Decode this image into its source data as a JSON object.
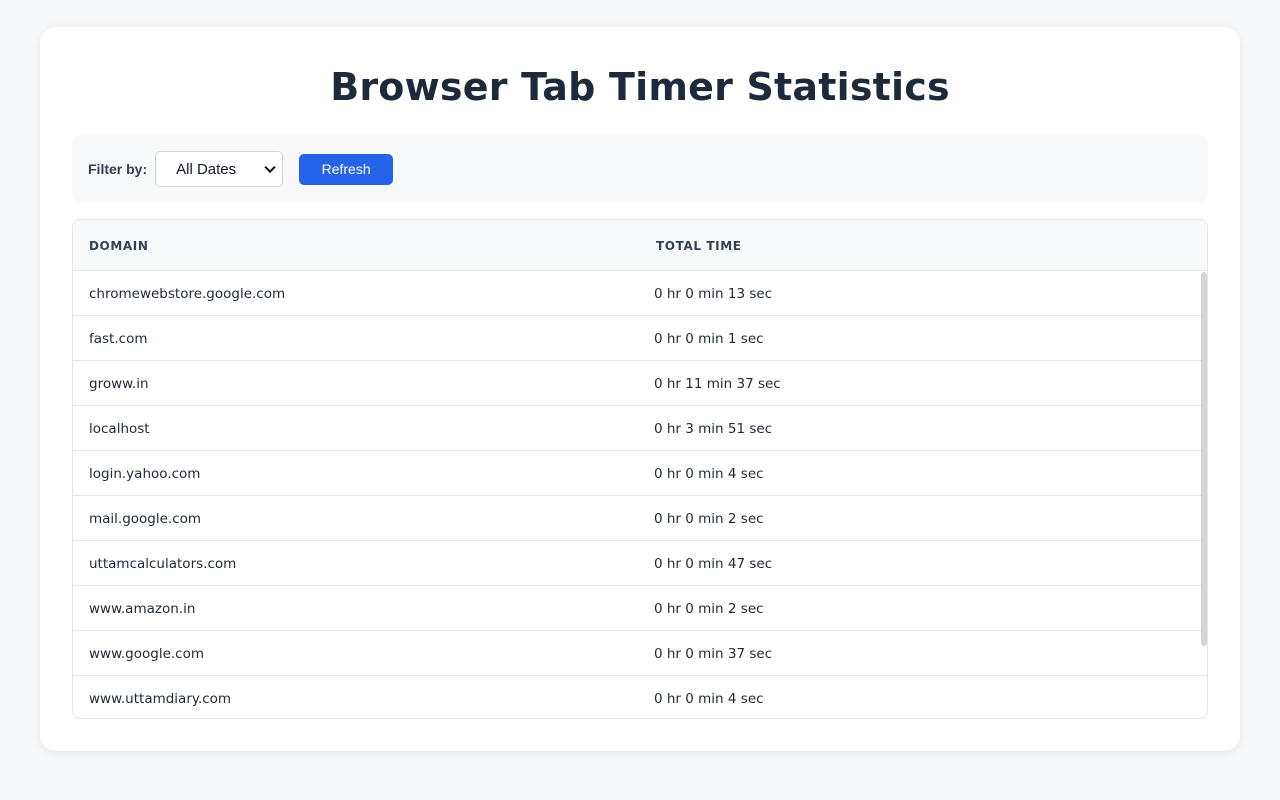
{
  "page": {
    "title": "Browser Tab Timer Statistics"
  },
  "filter": {
    "label": "Filter by:",
    "selected": "All Dates",
    "refresh_label": "Refresh"
  },
  "table": {
    "headers": {
      "domain": "DOMAIN",
      "total_time": "TOTAL TIME"
    },
    "rows": [
      {
        "domain": "chromewebstore.google.com",
        "time": "0 hr 0 min 13 sec"
      },
      {
        "domain": "fast.com",
        "time": "0 hr 0 min 1 sec"
      },
      {
        "domain": "groww.in",
        "time": "0 hr 11 min 37 sec"
      },
      {
        "domain": "localhost",
        "time": "0 hr 3 min 51 sec"
      },
      {
        "domain": "login.yahoo.com",
        "time": "0 hr 0 min 4 sec"
      },
      {
        "domain": "mail.google.com",
        "time": "0 hr 0 min 2 sec"
      },
      {
        "domain": "uttamcalculators.com",
        "time": "0 hr 0 min 47 sec"
      },
      {
        "domain": "www.amazon.in",
        "time": "0 hr 0 min 2 sec"
      },
      {
        "domain": "www.google.com",
        "time": "0 hr 0 min 37 sec"
      },
      {
        "domain": "www.uttamdiary.com",
        "time": "0 hr 0 min 4 sec"
      }
    ]
  },
  "colors": {
    "accent": "#2563eb",
    "title": "#1e293b",
    "background": "#f7f8fa"
  }
}
